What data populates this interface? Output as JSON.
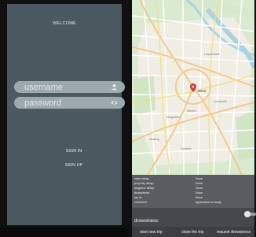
{
  "login": {
    "welcome": "WELCOME",
    "username_placeholder": "username",
    "password_placeholder": "password",
    "sign_in": "SIGN IN",
    "sign_up": "SIGN UP"
  },
  "map": {
    "city_label": "Wien",
    "places": [
      {
        "name": "Leopoldstadt"
      },
      {
        "name": "Wieden"
      },
      {
        "name": "Margareten"
      },
      {
        "name": "Favoriten"
      },
      {
        "name": "Landstraße"
      },
      {
        "name": "Meidling"
      }
    ]
  },
  "trip_info": [
    {
      "label": "state delay:",
      "value": "None"
    },
    {
      "label": "property delay:",
      "value": "None"
    },
    {
      "label": "neighbor delay:",
      "value": "None"
    },
    {
      "label": "drowsiness:",
      "value": "None"
    },
    {
      "label": "trip id:",
      "value": "None"
    },
    {
      "label": "comment:",
      "value": "application is ready"
    }
  ],
  "drowsiness": {
    "label": "drowsiness:"
  },
  "actions": {
    "start": "start new trip",
    "close": "close the trip",
    "request": "request drowsiness"
  },
  "colors": {
    "login_background": "#4b5961",
    "field_background": "#9ea9ae",
    "info_panel": "#5a5d60",
    "action_bar": "#3d4043",
    "map_marker": "#d93a3a"
  }
}
